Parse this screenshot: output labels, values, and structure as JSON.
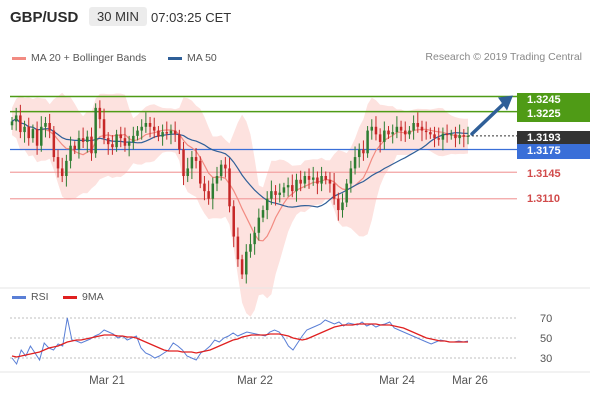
{
  "header": {
    "symbol": "GBP/USD",
    "timeframe": "30 MIN",
    "time": "07:03:25 CET"
  },
  "legend": {
    "ma20_bb": "MA 20 + Bollinger Bands",
    "ma50": "MA 50",
    "credit": "Research © 2019 Trading Central"
  },
  "rsi_legend": {
    "rsi": "RSI",
    "ma9": "9MA"
  },
  "colors": {
    "up": "#2e7d32",
    "down": "#c62828",
    "ma20": "#f28b82",
    "bb_fill": "#fde2df",
    "ma50": "#2f5f98",
    "resistance": "#4f9b16",
    "pivot": "#3a6fd8",
    "support": "#f2a2a2",
    "current": "#333333",
    "arrow": "#2f5f98"
  },
  "levels": {
    "r2": "1.3245",
    "r1": "1.3225",
    "current": "1.3193",
    "pivot": "1.3175",
    "s1": "1.3145",
    "s2": "1.3110"
  },
  "chart_data": [
    {
      "type": "candlestick",
      "title": "GBP/USD 30 MIN",
      "x_ticks": [
        "Mar 21",
        "Mar 22",
        "Mar 24",
        "Mar 26"
      ],
      "ylim": [
        1.3,
        1.328
      ],
      "series_close": [
        1.3212,
        1.322,
        1.3198,
        1.3205,
        1.319,
        1.3202,
        1.318,
        1.3205,
        1.321,
        1.32,
        1.3165,
        1.315,
        1.314,
        1.316,
        1.318,
        1.3175,
        1.319,
        1.3185,
        1.3192,
        1.317,
        1.323,
        1.3215,
        1.319,
        1.3182,
        1.3178,
        1.3195,
        1.319,
        1.318,
        1.3185,
        1.3193,
        1.32,
        1.3205,
        1.321,
        1.3205,
        1.32,
        1.3192,
        1.3198,
        1.3196,
        1.32,
        1.3195,
        1.3175,
        1.314,
        1.315,
        1.3165,
        1.316,
        1.313,
        1.312,
        1.311,
        1.313,
        1.314,
        1.3155,
        1.315,
        1.31,
        1.306,
        1.303,
        1.301,
        1.304,
        1.305,
        1.3065,
        1.3085,
        1.3095,
        1.311,
        1.312,
        1.3115,
        1.3118,
        1.3125,
        1.3128,
        1.312,
        1.3135,
        1.313,
        1.314,
        1.3135,
        1.3138,
        1.313,
        1.314,
        1.3135,
        1.313,
        1.311,
        1.3095,
        1.3105,
        1.313,
        1.315,
        1.3165,
        1.3175,
        1.317,
        1.32,
        1.3205,
        1.3195,
        1.3185,
        1.32,
        1.3195,
        1.3198,
        1.3205,
        1.32,
        1.3195,
        1.32,
        1.321,
        1.3205,
        1.32,
        1.3198,
        1.3195,
        1.319,
        1.3188,
        1.3196,
        1.3194,
        1.3195,
        1.319,
        1.3194,
        1.3192,
        1.3193
      ],
      "ma20": "line",
      "bollinger_bands": true,
      "ma50": "line"
    },
    {
      "type": "line",
      "title": "RSI",
      "yticks": [
        30,
        50,
        70
      ],
      "series": [
        {
          "name": "RSI"
        },
        {
          "name": "9MA"
        }
      ],
      "rsi": [
        30,
        24,
        38,
        32,
        42,
        35,
        28,
        45,
        40,
        38,
        44,
        42,
        70,
        48,
        47,
        45,
        47,
        49,
        52,
        54,
        58,
        56,
        54,
        50,
        52,
        48,
        50,
        52,
        40,
        35,
        33,
        30,
        32,
        35,
        38,
        45,
        42,
        38,
        32,
        30,
        28,
        35,
        38,
        42,
        48,
        46,
        50,
        52,
        55,
        52,
        54,
        56,
        55,
        54,
        53,
        52,
        56,
        58,
        56,
        50,
        42,
        38,
        45,
        52,
        58,
        60,
        62,
        64,
        68,
        66,
        64,
        66,
        62,
        65,
        64,
        63,
        66,
        62,
        64,
        61,
        63,
        64,
        66,
        60,
        58,
        56,
        54,
        52,
        50,
        48,
        46,
        44,
        46,
        48,
        47,
        46,
        46,
        47,
        46,
        47
      ],
      "ma9": [
        32,
        31,
        32,
        33,
        34,
        35,
        36,
        38,
        40,
        41,
        42,
        44,
        46,
        47,
        48,
        48,
        49,
        50,
        51,
        52,
        53,
        53,
        53,
        52,
        52,
        51,
        51,
        50,
        48,
        46,
        44,
        42,
        40,
        38,
        37,
        37,
        37,
        36,
        36,
        36,
        35,
        36,
        37,
        38,
        40,
        42,
        44,
        46,
        48,
        49,
        51,
        52,
        53,
        53,
        53,
        53,
        54,
        54,
        54,
        53,
        52,
        50,
        49,
        48,
        49,
        51,
        53,
        55,
        57,
        59,
        61,
        62,
        63,
        63,
        63,
        64,
        64,
        64,
        64,
        64,
        63,
        63,
        63,
        62,
        61,
        60,
        58,
        56,
        54,
        52,
        50,
        49,
        48,
        47,
        47,
        46,
        46,
        46,
        46,
        46
      ]
    }
  ]
}
